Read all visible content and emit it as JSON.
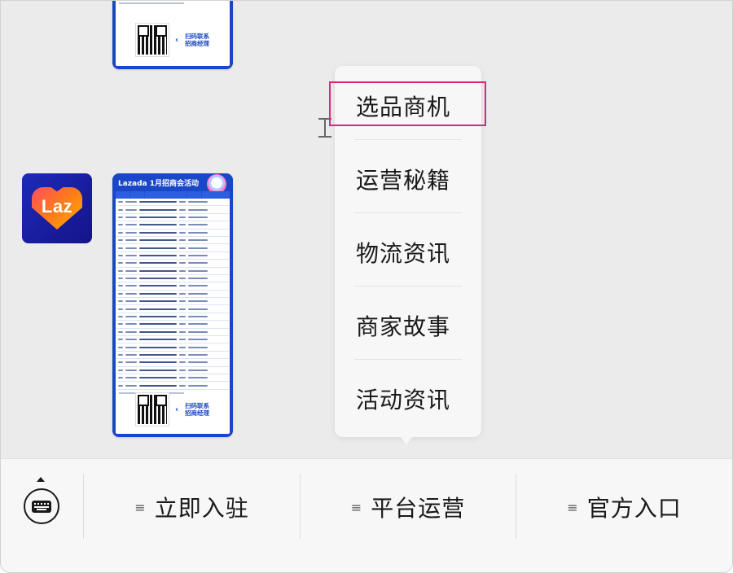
{
  "poster": {
    "title": "Lazada 1月招商会活动",
    "qr_label": "扫码联系\n招商经理"
  },
  "avatar": {
    "logo_text": "Laz"
  },
  "popup_menu": {
    "items": [
      {
        "label": "选品商机"
      },
      {
        "label": "运营秘籍"
      },
      {
        "label": "物流资讯"
      },
      {
        "label": "商家故事"
      },
      {
        "label": "活动资讯"
      }
    ],
    "highlight_color": "#e0257a"
  },
  "bottom_bar": {
    "keyboard_icon": "keyboard-icon",
    "tabs": [
      {
        "icon": "menu-icon",
        "label": "立即入驻"
      },
      {
        "icon": "menu-icon",
        "label": "平台运营"
      },
      {
        "icon": "menu-icon",
        "label": "官方入口"
      }
    ]
  },
  "colors": {
    "poster_blue": "#1a47c7",
    "background": "#ebebeb",
    "popup_bg": "#f7f7f7"
  }
}
